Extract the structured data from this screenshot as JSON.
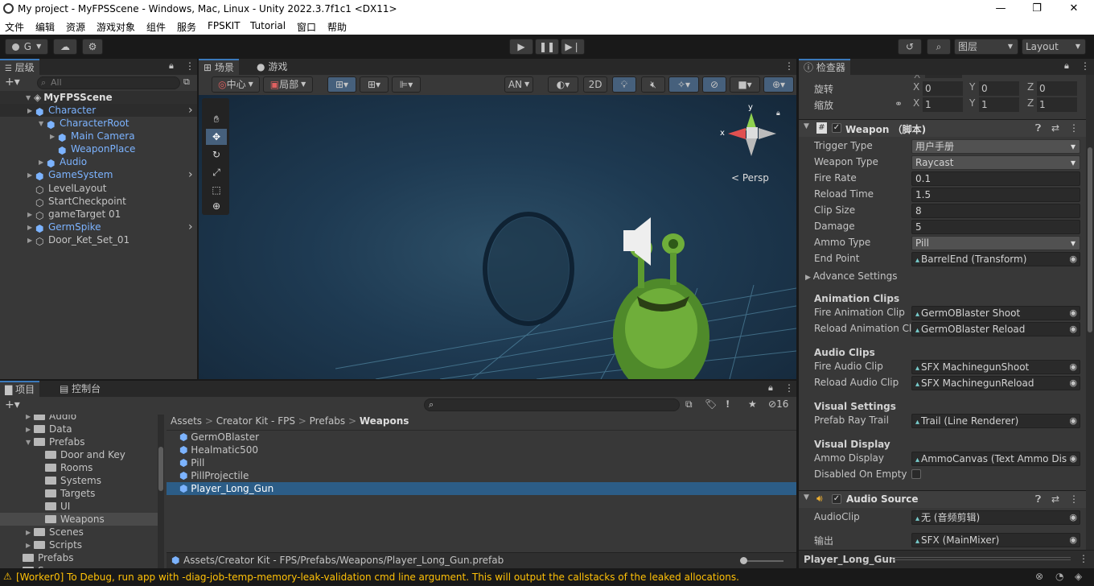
{
  "window": {
    "title": "My project - MyFPSScene - Windows, Mac, Linux - Unity 2022.3.7f1c1 <DX11>",
    "min": "—",
    "max": "❐",
    "close": "✕"
  },
  "menu": [
    "文件",
    "编辑",
    "资源",
    "游戏对象",
    "组件",
    "服务",
    "FPSKIT",
    "Tutorial",
    "窗口",
    "帮助"
  ],
  "toolbar": {
    "account": "G",
    "layers": "图层",
    "layout": "Layout"
  },
  "hierarchy": {
    "tab": "层级",
    "search_placeholder": "All",
    "scene": "MyFPSScene",
    "items": [
      {
        "label": "Character",
        "blue": true
      },
      {
        "label": "CharacterRoot",
        "blue": true
      },
      {
        "label": "Main Camera",
        "blue": true
      },
      {
        "label": "WeaponPlace",
        "blue": true
      },
      {
        "label": "Audio",
        "blue": true
      },
      {
        "label": "GameSystem",
        "blue": true
      },
      {
        "label": "LevelLayout",
        "blue": false
      },
      {
        "label": "StartCheckpoint",
        "blue": false
      },
      {
        "label": "gameTarget 01",
        "blue": false
      },
      {
        "label": "GermSpike",
        "blue": true
      },
      {
        "label": "Door_Ket_Set_01",
        "blue": false
      }
    ]
  },
  "scene": {
    "tabs": [
      "场景",
      "游戏"
    ],
    "pivot": "中心",
    "space": "局部",
    "an": "AN",
    "mode2d": "2D",
    "persp": "< Persp",
    "gizmo_x": "x",
    "gizmo_y": "y"
  },
  "project": {
    "tabs": [
      "项目",
      "控制台"
    ],
    "count": "16",
    "folders": [
      "Audio",
      "Data",
      "Prefabs",
      "Door and Key",
      "Rooms",
      "Systems",
      "Targets",
      "UI",
      "Weapons",
      "Scenes",
      "Scripts",
      "Prefabs",
      "Scenes"
    ],
    "breadcrumb": [
      "Assets",
      "Creator Kit - FPS",
      "Prefabs",
      "Weapons"
    ],
    "assets": [
      "GermOBlaster",
      "Healmatic500",
      "Pill",
      "PillProjectile",
      "Player_Long_Gun"
    ],
    "path": "Assets/Creator Kit - FPS/Prefabs/Weapons/Player_Long_Gun.prefab"
  },
  "inspector": {
    "tab": "检查器",
    "transform": {
      "rot_label": "旋转",
      "scale_label": "缩放",
      "rot": [
        "0",
        "0",
        "0"
      ],
      "scale": [
        "1",
        "1",
        "1"
      ],
      "axes": [
        "X",
        "Y",
        "Z"
      ]
    },
    "weapon_component": "Weapon （脚本)",
    "fields": [
      {
        "label": "Trigger Type",
        "value": "用户手册",
        "kind": "drop"
      },
      {
        "label": "Weapon Type",
        "value": "Raycast",
        "kind": "drop"
      },
      {
        "label": "Fire Rate",
        "value": "0.1",
        "kind": "text"
      },
      {
        "label": "Reload Time",
        "value": "1.5",
        "kind": "text"
      },
      {
        "label": "Clip Size",
        "value": "8",
        "kind": "text"
      },
      {
        "label": "Damage",
        "value": "5",
        "kind": "text"
      },
      {
        "label": "Ammo Type",
        "value": "Pill",
        "kind": "drop"
      },
      {
        "label": "End Point",
        "value": "BarrelEnd (Transform)",
        "kind": "obj"
      }
    ],
    "advance": "Advance Settings",
    "anim_section": "Animation Clips",
    "anim_fields": [
      {
        "label": "Fire Animation Clip",
        "value": "GermOBlaster Shoot"
      },
      {
        "label": "Reload Animation Cl",
        "value": "GermOBlaster Reload"
      }
    ],
    "audio_section": "Audio Clips",
    "audio_fields": [
      {
        "label": "Fire Audio Clip",
        "value": "SFX MachinegunShoot"
      },
      {
        "label": "Reload Audio Clip",
        "value": "SFX MachinegunReload"
      }
    ],
    "visual_section": "Visual Settings",
    "visual_fields": [
      {
        "label": "Prefab Ray Trail",
        "value": "Trail (Line Renderer)"
      }
    ],
    "display_section": "Visual Display",
    "display_fields": [
      {
        "label": "Ammo Display",
        "value": "AmmoCanvas (Text Ammo Dis"
      },
      {
        "label": "Disabled On Empty",
        "value": ""
      }
    ],
    "audio_source": "Audio Source",
    "audio_source_fields": [
      {
        "label": "AudioClip",
        "value": "无 (音频剪辑)"
      },
      {
        "label": "输出",
        "value": "SFX (MainMixer)"
      }
    ],
    "footer": "Player_Long_Gun"
  },
  "status": {
    "message": "[Worker0] To Debug, run app with -diag-job-temp-memory-leak-validation cmd line argument. This will output the callstacks of the leaked allocations."
  },
  "colors": {
    "selection": "#2c5d87",
    "accent": "#3a79bb",
    "warning": "#ffc107",
    "prefab_blue": "#7cb3ff"
  }
}
